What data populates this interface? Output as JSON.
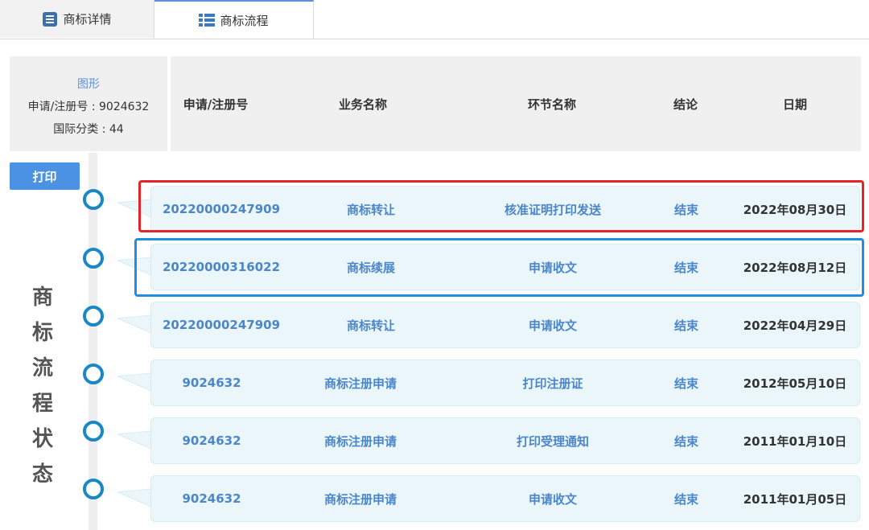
{
  "tabs": [
    {
      "label": "商标详情",
      "icon": "document-list-icon"
    },
    {
      "label": "商标流程",
      "icon": "grid-list-icon"
    }
  ],
  "info": {
    "image_link": "图形",
    "reg_no": "申请/注册号 : 9024632",
    "class": "国际分类 : 44"
  },
  "columns": [
    "申请/注册号",
    "业务名称",
    "环节名称",
    "结论",
    "日期"
  ],
  "print_label": "打印",
  "side_title": [
    "商",
    "标",
    "流",
    "程",
    "状",
    "态"
  ],
  "rows": [
    {
      "no": "20220000247909",
      "business": "商标转让",
      "step": "核准证明打印发送",
      "result": "结束",
      "date": "2022年08月30日"
    },
    {
      "no": "20220000316022",
      "business": "商标续展",
      "step": "申请收文",
      "result": "结束",
      "date": "2022年08月12日"
    },
    {
      "no": "20220000247909",
      "business": "商标转让",
      "step": "申请收文",
      "result": "结束",
      "date": "2022年04月29日"
    },
    {
      "no": "9024632",
      "business": "商标注册申请",
      "step": "打印注册证",
      "result": "结束",
      "date": "2012年05月10日"
    },
    {
      "no": "9024632",
      "business": "商标注册申请",
      "step": "打印受理通知",
      "result": "结束",
      "date": "2011年01月10日"
    },
    {
      "no": "9024632",
      "business": "商标注册申请",
      "step": "申请收文",
      "result": "结束",
      "date": "2011年01月05日"
    }
  ],
  "colors": {
    "accent": "#4b92e4",
    "link": "#4b86c9",
    "timeline": "#1a87c7",
    "highlight_red": "#e4232a",
    "highlight_blue": "#1e8fe6"
  }
}
